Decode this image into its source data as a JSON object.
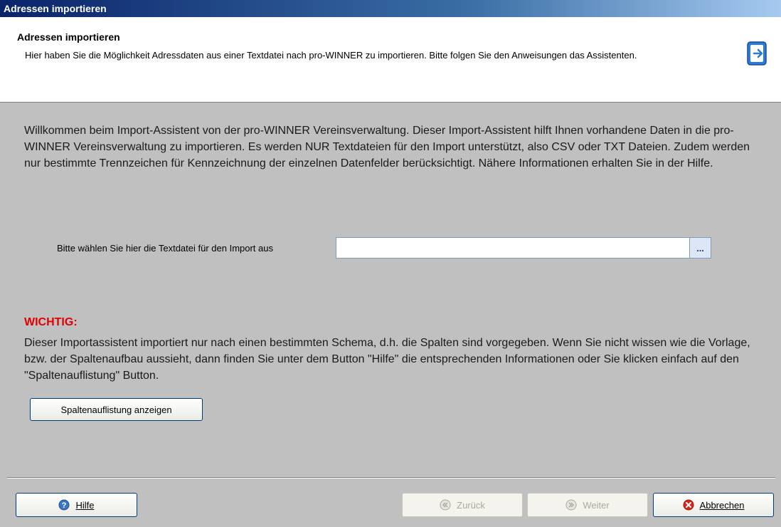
{
  "window": {
    "title": "Adressen importieren"
  },
  "header": {
    "title": "Adressen importieren",
    "description": "Hier haben Sie die Möglichkeit Adressdaten aus einer Textdatei nach pro-WINNER zu importieren. Bitte folgen Sie den Anweisungen das Assistenten.",
    "icon": "import-wizard-icon"
  },
  "main": {
    "welcome_text": "Willkommen beim Import-Assistent von der pro-WINNER Vereinsverwaltung. Dieser Import-Assistent hilft Ihnen vorhandene Daten in die pro-WINNER Vereinsverwaltung zu importieren. Es werden NUR Textdateien für den Import unterstützt, also CSV oder TXT Dateien. Zudem werden nur bestimmte Trennzeichen für Kennzeichnung der einzelnen Datenfelder berücksichtigt. Nähere Informationen erhalten Sie in der Hilfe.",
    "file_label": "Bitte wählen Sie hier die Textdatei für den Import aus",
    "file_value": "",
    "browse_label": "...",
    "warning_title": "WICHTIG:",
    "warning_text": "Dieser Importassistent importiert nur nach einen bestimmten Schema, d.h. die Spalten sind vorgegeben. Wenn Sie nicht wissen wie die Vorlage, bzw. der Spaltenaufbau aussieht, dann finden Sie unter dem Button \"Hilfe\" die entsprechenden Informationen oder Sie klicken einfach auf den \"Spaltenauflistung\" Button.",
    "columns_button": "Spaltenauflistung anzeigen"
  },
  "footer": {
    "help": "Hilfe",
    "back": "Zurück",
    "next": "Weiter",
    "cancel": "Abbrechen"
  },
  "colors": {
    "title_bar": "#0a246a",
    "warning": "#e00000",
    "panel": "#c0c0c0"
  }
}
